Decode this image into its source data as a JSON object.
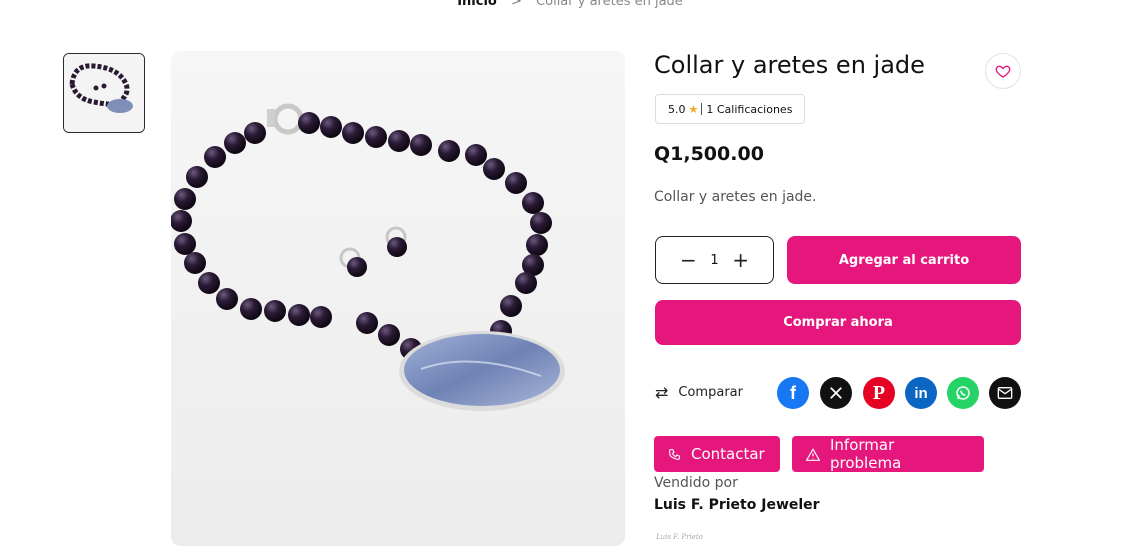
{
  "breadcrumb": {
    "home": "Inicio",
    "separator": ">",
    "current": "Collar y aretes en jade"
  },
  "product": {
    "title": "Collar y aretes en jade",
    "rating_value": "5.0",
    "rating_label": "1 Calificaciones",
    "price": "Q1,500.00",
    "description": "Collar y aretes en jade.",
    "quantity": "1"
  },
  "actions": {
    "add_to_cart": "Agregar al carrito",
    "buy_now": "Comprar ahora",
    "compare": "Comparar",
    "contact": "Contactar",
    "report_problem": "Informar problema"
  },
  "share_icons": [
    "facebook-icon",
    "x-icon",
    "pinterest-icon",
    "linkedin-icon",
    "whatsapp-icon",
    "email-icon"
  ],
  "seller": {
    "sold_by_label": "Vendido por",
    "name": "Luis F. Prieto Jeweler",
    "logo_text": "Luis F. Prieto"
  },
  "colors": {
    "accent": "#e6177c",
    "facebook": "#1877f2",
    "x": "#111111",
    "pinterest": "#e60023",
    "linkedin": "#0a66c2",
    "whatsapp": "#25d366",
    "email": "#111111",
    "star": "#f5a623"
  }
}
